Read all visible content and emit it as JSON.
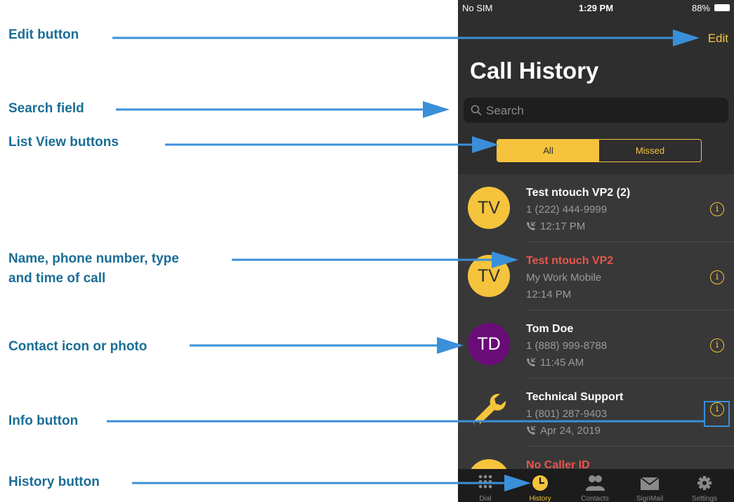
{
  "callouts": {
    "edit": "Edit button",
    "search": "Search field",
    "list_view": "List View buttons",
    "name_line1": "Name, phone number, type",
    "name_line2": "and time of call",
    "contact_icon": "Contact icon or photo",
    "info": "Info button",
    "history": "History button"
  },
  "status_bar": {
    "carrier": "No SIM",
    "time": "1:29 PM",
    "battery": "88%"
  },
  "header": {
    "edit_label": "Edit",
    "title": "Call History"
  },
  "search": {
    "placeholder": "Search"
  },
  "segments": [
    {
      "label": "All",
      "active": true
    },
    {
      "label": "Missed",
      "active": false
    }
  ],
  "calls": [
    {
      "initials": "TV",
      "avatar_color": "#f5c43c",
      "name": "Test ntouch VP2 (2)",
      "detail": "1 (222) 444-9999",
      "time": "12:17 PM",
      "missed": false,
      "icon": "phone-call-icon"
    },
    {
      "initials": "TV",
      "avatar_color": "#f5c43c",
      "name": "Test ntouch VP2",
      "detail": "My Work Mobile",
      "time": "12:14 PM",
      "missed": true,
      "icon": ""
    },
    {
      "initials": "TD",
      "avatar_color": "#6a0c78",
      "name": "Tom Doe",
      "detail": "1 (888) 999-8788",
      "time": "11:45 AM",
      "missed": false,
      "icon": "phone-call-icon"
    },
    {
      "initials": "",
      "avatar_color": "#f5c43c",
      "name": "Technical Support",
      "detail": "1 (801) 287-9403",
      "time": "Apr 24, 2019",
      "missed": false,
      "icon": "wrench-icon"
    },
    {
      "initials": "",
      "avatar_color": "#f5c43c",
      "name": "No Caller ID",
      "detail": "",
      "time": "",
      "missed": true,
      "icon": ""
    }
  ],
  "tabs": [
    {
      "label": "Dial",
      "icon": "dialpad-icon",
      "active": false
    },
    {
      "label": "History",
      "icon": "clock-icon",
      "active": true
    },
    {
      "label": "Contacts",
      "icon": "contacts-icon",
      "active": false
    },
    {
      "label": "SignMail",
      "icon": "envelope-icon",
      "active": false
    },
    {
      "label": "Settings",
      "icon": "gear-icon",
      "active": false
    }
  ],
  "colors": {
    "accent": "#f5c43c",
    "missed": "#e8564c",
    "callout_text": "#1a6e96",
    "arrow": "#3a8fd9",
    "background": "#2e2e2e"
  }
}
